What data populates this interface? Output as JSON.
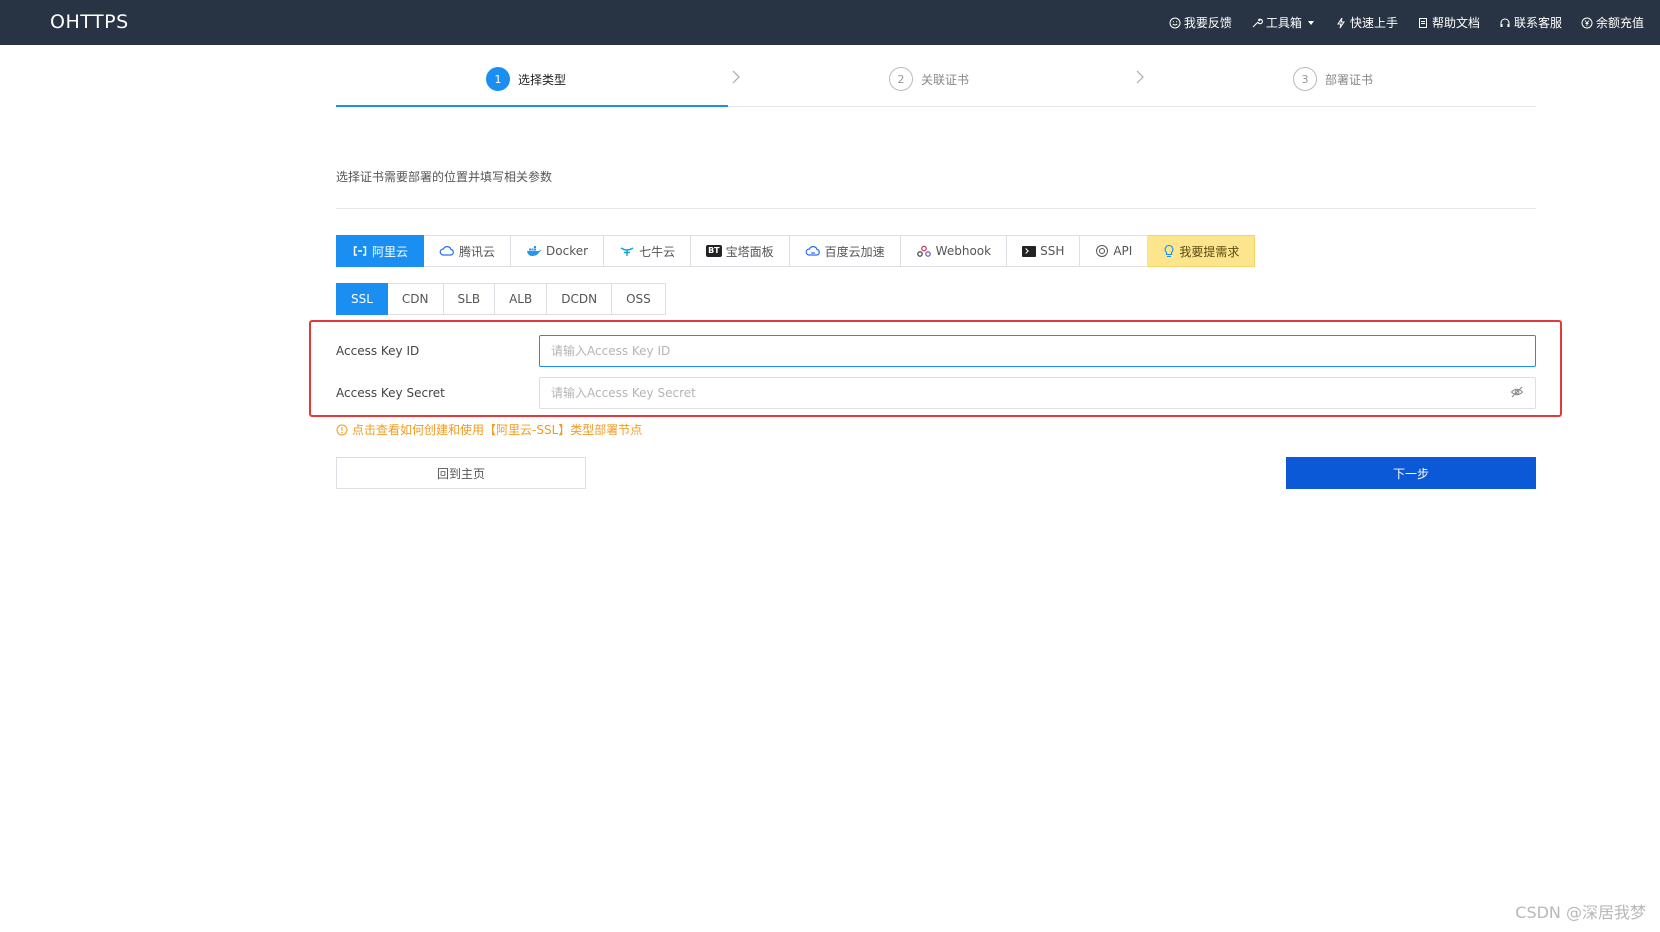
{
  "header": {
    "brand": "OHTTPS",
    "nav": [
      {
        "label": "我要反馈",
        "icon": "smile-icon"
      },
      {
        "label": "工具箱",
        "icon": "wrench-icon"
      },
      {
        "label": "快速上手",
        "icon": "bolt-icon"
      },
      {
        "label": "帮助文档",
        "icon": "document-icon"
      },
      {
        "label": "联系客服",
        "icon": "headset-icon"
      },
      {
        "label": "余额充值",
        "icon": "yen-icon"
      }
    ]
  },
  "steps": [
    {
      "num": "1",
      "label": "选择类型",
      "active": true
    },
    {
      "num": "2",
      "label": "关联证书",
      "active": false
    },
    {
      "num": "3",
      "label": "部署证书",
      "active": false
    }
  ],
  "description": "选择证书需要部署的位置并填写相关参数",
  "provider_tabs": [
    {
      "label": "阿里云",
      "icon": "aliyun-icon"
    },
    {
      "label": "腾讯云",
      "icon": "tencent-cloud-icon"
    },
    {
      "label": "Docker",
      "icon": "docker-icon"
    },
    {
      "label": "七牛云",
      "icon": "qiniu-icon"
    },
    {
      "label": "宝塔面板",
      "icon": "bt-panel-icon"
    },
    {
      "label": "百度云加速",
      "icon": "baidu-cloud-icon"
    },
    {
      "label": "Webhook",
      "icon": "webhook-icon"
    },
    {
      "label": "SSH",
      "icon": "terminal-icon"
    },
    {
      "label": "API",
      "icon": "api-icon"
    },
    {
      "label": "我要提需求",
      "icon": "lightbulb-icon"
    }
  ],
  "service_tabs": [
    "SSL",
    "CDN",
    "SLB",
    "ALB",
    "DCDN",
    "OSS"
  ],
  "form": {
    "access_key_id": {
      "label": "Access Key ID",
      "value": "",
      "placeholder": "请输入Access Key ID"
    },
    "access_key_secret": {
      "label": "Access Key Secret",
      "value": "",
      "placeholder": "请输入Access Key Secret"
    }
  },
  "hint": "点击查看如何创建和使用【阿里云-SSL】类型部署节点",
  "buttons": {
    "home": "回到主页",
    "next": "下一步"
  },
  "watermark": "CSDN @深居我梦",
  "colors": {
    "header_bg": "#283443",
    "primary": "#1b8ef2",
    "next_button": "#0b59d6",
    "highlight_border": "#e5383b",
    "hint": "#f39a1f",
    "request_tab": "#fde58d"
  }
}
